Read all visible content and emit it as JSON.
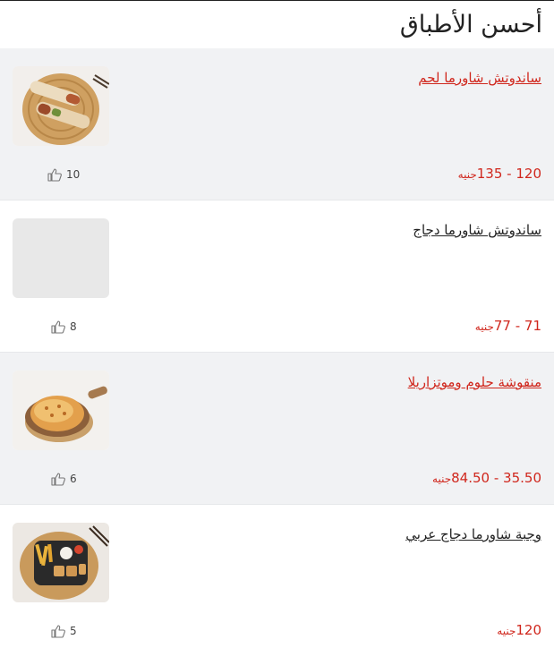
{
  "page": {
    "title": "أحسن الأطباق"
  },
  "dishes": [
    {
      "name": "ساندوتش شاورما لحم",
      "price_range": "120 - 135",
      "currency": "جنيه",
      "likes": "10",
      "image": "beef-shawarma-wraps"
    },
    {
      "name": "ساندوتش شاورما دجاج",
      "price_range": "71 - 77",
      "currency": "جنيه",
      "likes": "8",
      "image": "placeholder"
    },
    {
      "name": "منقوشة حلوم وموتزاريلا",
      "price_range": "35.50 - 84.50",
      "currency": "جنيه",
      "likes": "6",
      "image": "manakish-on-board"
    },
    {
      "name": "وجبة شاورما دجاج عربي",
      "price_range": "120",
      "currency": "جنيه",
      "likes": "5",
      "image": "arabic-shawarma-meal"
    }
  ],
  "icons": {
    "likes": "thumbs-up-icon"
  },
  "colors": {
    "accent": "#d0271d",
    "row_shade": "#f1f2f4",
    "text": "#222222"
  }
}
